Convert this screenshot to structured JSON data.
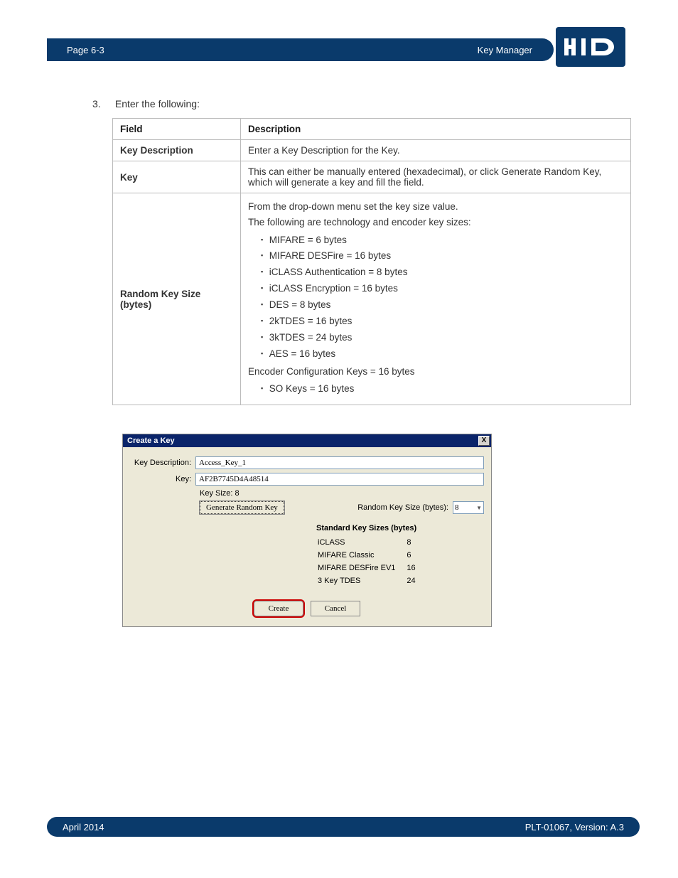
{
  "header": {
    "page": "Page 6-3",
    "section": "Key Manager",
    "logo_text": "HID"
  },
  "step": {
    "number": "3.",
    "text": "Enter the following:"
  },
  "table": {
    "headers": {
      "field": "Field",
      "description": "Description"
    },
    "rows": [
      {
        "field": "Key Description",
        "desc_plain": "Enter a Key Description for the Key."
      },
      {
        "field": "Key",
        "desc_plain": "This can either be manually entered (hexadecimal), or click Generate Random Key, which will generate a key and fill the field."
      },
      {
        "field": "Random Key Size (bytes)",
        "desc_intro1": "From the drop-down menu set the key size value.",
        "desc_intro2": "The following are technology and encoder key sizes:",
        "bullets": [
          "MIFARE = 6 bytes",
          "MIFARE DESFire = 16 bytes",
          "iCLASS Authentication = 8 bytes",
          "iCLASS Encryption = 16 bytes",
          "DES = 8 bytes",
          "2kTDES = 16 bytes",
          "3kTDES = 24 bytes",
          "AES = 16 bytes"
        ],
        "post1": "Encoder Configuration Keys = 16 bytes",
        "post_bullets": [
          "SO Keys = 16 bytes"
        ]
      }
    ]
  },
  "dialog": {
    "title": "Create a Key",
    "close": "X",
    "labels": {
      "key_description": "Key Description:",
      "key": "Key:",
      "key_size": "Key Size:",
      "random_key_size": "Random Key Size (bytes):"
    },
    "values": {
      "key_description": "Access_Key_1",
      "key": "AF2B7745D4A48514",
      "key_size": "8",
      "random_key_size_selected": "8"
    },
    "buttons": {
      "generate": "Generate Random Key",
      "create": "Create",
      "cancel": "Cancel"
    },
    "standard": {
      "title": "Standard Key Sizes (bytes)",
      "rows": [
        {
          "name": "iCLASS",
          "size": "8"
        },
        {
          "name": "MIFARE Classic",
          "size": "6"
        },
        {
          "name": "MIFARE DESFire EV1",
          "size": "16"
        },
        {
          "name": "3 Key TDES",
          "size": "24"
        }
      ]
    }
  },
  "footer": {
    "date": "April 2014",
    "doc": "PLT-01067, Version: A.3"
  }
}
